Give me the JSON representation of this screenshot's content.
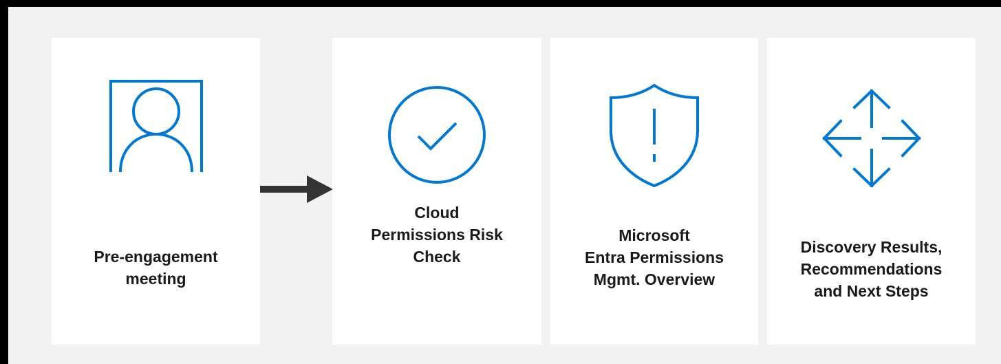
{
  "steps": [
    {
      "label": "Pre-engagement\nmeeting",
      "icon": "person-portrait-icon"
    },
    {
      "label": "Cloud\nPermissions Risk\nCheck",
      "icon": "checkmark-circle-icon"
    },
    {
      "label": "Microsoft\nEntra Permissions\nMgmt. Overview",
      "icon": "shield-alert-icon"
    },
    {
      "label": "Discovery Results,\nRecommendations\nand Next Steps",
      "icon": "move-arrows-icon"
    }
  ],
  "colors": {
    "accent": "#0078d4",
    "card": "#ffffff",
    "background": "#f2f2f2",
    "arrow": "#333333"
  }
}
